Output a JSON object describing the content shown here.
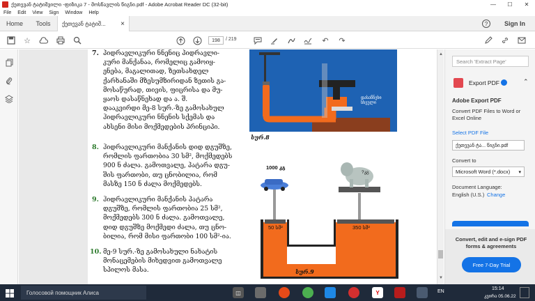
{
  "window": {
    "title": "ქეთევან ტატიშვილი -ფიზიკა 7 - მოსწავლის წიგნი.pdf - Adobe Acrobat Reader DC (32-bit)",
    "min": "—",
    "max": "☐",
    "close": "✕"
  },
  "menu": [
    "File",
    "Edit",
    "View",
    "Sign",
    "Window",
    "Help"
  ],
  "tabs": {
    "home": "Home",
    "tools": "Tools",
    "doc": "ქეთევან ტატიშ...",
    "doc_close": "×",
    "sign_in": "Sign In",
    "help": "?"
  },
  "toolbar": {
    "page": "198",
    "total": "/ 219"
  },
  "page_content": {
    "item7_num": "7.",
    "item7": [
      "პიდრავლიკური ნნენიც პიდრავლი-",
      "კური მანქანაა, რომელიც გამოიყ-",
      "ენება, მაგალითად, ზეთსახდელ",
      "ქარხანაში მზესუმზირიდან ზეთის გა-",
      "მოსაწურად, თივის, ფიცრისა და მუ-",
      "ყაოს დასაწნეხად და ა. შ.",
      "დააკვირდი მე-8 სურ.-ზე გამოსახულ",
      "ჰიდრავლიკური ნნენის სქემას და",
      "ახსენი მისი მოქმედების პრინციპი."
    ],
    "item8_num": "8.",
    "item8": [
      "ჰიდრავლიკური მანქანის დიდ დგუშზე,",
      "რომლის ფართობია 30 სმ², მოქმედებს",
      "900 ნ ძალა. გამოთვალე, პატარა დგუ-",
      "შის ფართობი, თუ ცნობილია, რომ",
      "მასზე 150 ნ ძალა მოქმედებს."
    ],
    "item9_num": "9.",
    "item9": [
      "ჰიდრავლიკური მანქანის პატარა",
      "დგუშზე, რომლის ფართობია 25 სმ²,",
      "მოქმედებს 300 ნ ძალა. გამოთვალე,",
      "დიდ დგუშზე მოქმედი ძალა, თუ ცნო-",
      "ბილია, რომ მისი ფართობი 100 სმ²-ია."
    ],
    "item10_num": "10.",
    "item10": [
      "მე-9 სურ.-ზე გამოსახული ნახატის",
      "მონაცემების მიხედვით გამოთვალე",
      "სპილოს მასა."
    ],
    "fig8_caption": "სურ.8",
    "fig8_label": "დასაწნეხი სხეული",
    "fig9_caption": "სურ.9",
    "fig9_car_mass": "1000 კგ",
    "fig9_small_area": "50 სმ²",
    "fig9_large_area": "350 სმ²",
    "fig9_elephant": "?კგ"
  },
  "right_panel": {
    "search_placeholder": "Search 'Extract Page'",
    "export_header": "Export PDF",
    "adobe_export": "Adobe Export PDF",
    "convert_desc": "Convert PDF Files to Word or Excel Online",
    "select_file": "Select PDF File",
    "file_name": "ქეთევან ტა... წიგნი.pdf",
    "convert_to": "Convert to",
    "format": "Microsoft Word (*.docx)",
    "doc_lang_label": "Document Language:",
    "doc_lang": "English (U.S.)",
    "change": "Change",
    "promo": "Convert, edit and e-sign PDF forms & agreements",
    "trial": "Free 7-Day Trial"
  },
  "taskbar": {
    "search": "Голосовой помощник Алиса",
    "lang": "EN",
    "time": "15:14",
    "date": "კვირა 05.06.22"
  },
  "colors": {
    "orange": "#f26b1d",
    "blue": "#1e62b3",
    "dark": "#222"
  }
}
